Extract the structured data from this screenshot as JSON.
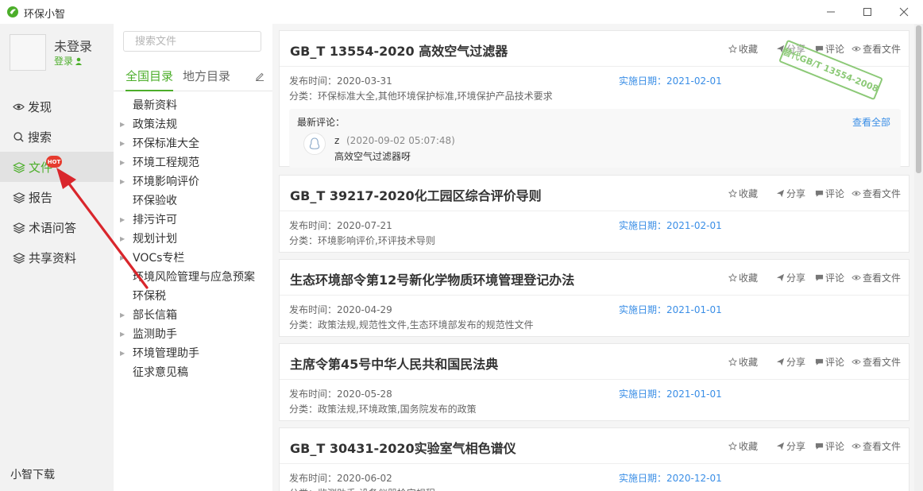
{
  "window": {
    "title": "环保小智"
  },
  "user": {
    "name": "未登录",
    "login_label": "登录"
  },
  "nav": {
    "items": [
      {
        "label": "发现",
        "icon": "eye-icon"
      },
      {
        "label": "搜索",
        "icon": "search-icon"
      },
      {
        "label": "文件",
        "icon": "layers-icon",
        "active": true,
        "badge": "HOT"
      },
      {
        "label": "报告",
        "icon": "layers-icon"
      },
      {
        "label": "术语问答",
        "icon": "layers-icon"
      },
      {
        "label": "共享资料",
        "icon": "layers-icon"
      }
    ],
    "download_label": "小智下载"
  },
  "directory": {
    "search_placeholder": "搜索文件",
    "tabs": [
      "全国目录",
      "地方目录"
    ],
    "items": [
      {
        "label": "最新资料",
        "expandable": false
      },
      {
        "label": "政策法规",
        "expandable": true
      },
      {
        "label": "环保标准大全",
        "expandable": true
      },
      {
        "label": "环境工程规范",
        "expandable": true
      },
      {
        "label": "环境影响评价",
        "expandable": true
      },
      {
        "label": "环保验收",
        "expandable": false
      },
      {
        "label": "排污许可",
        "expandable": true
      },
      {
        "label": "规划计划",
        "expandable": true
      },
      {
        "label": "VOCs专栏",
        "expandable": true
      },
      {
        "label": "环境风险管理与应急预案",
        "expandable": false
      },
      {
        "label": "环保税",
        "expandable": false
      },
      {
        "label": "部长信箱",
        "expandable": true
      },
      {
        "label": "监测助手",
        "expandable": true
      },
      {
        "label": "环境管理助手",
        "expandable": true
      },
      {
        "label": "征求意见稿",
        "expandable": false
      }
    ]
  },
  "actions": {
    "fav": "收藏",
    "share": "分享",
    "comment": "评论",
    "view": "查看文件"
  },
  "labels": {
    "publish": "发布时间：",
    "implement": "实施日期：",
    "category": "分类："
  },
  "docs": [
    {
      "title": "GB_T 13554-2020 高效空气过滤器",
      "publish": "2020-03-31",
      "implement": "2021-02-01",
      "category": "环保标准大全,其他环境保护标准,环境保护产品技术要求",
      "stamp": "替代GB/T 13554-2008",
      "comment": {
        "label": "最新评论：",
        "view_all": "查看全部",
        "user": "z",
        "time": "(2020-09-02 05:07:48)",
        "text": "高效空气过滤器呀"
      }
    },
    {
      "title": "GB_T 39217-2020化工园区综合评价导则",
      "publish": "2020-07-21",
      "implement": "2021-02-01",
      "category": "环境影响评价,环评技术导则"
    },
    {
      "title": "生态环境部令第12号新化学物质环境管理登记办法",
      "publish": "2020-04-29",
      "implement": "2021-01-01",
      "category": "政策法规,规范性文件,生态环境部发布的规范性文件"
    },
    {
      "title": "主席令第45号中华人民共和国民法典",
      "publish": "2020-05-28",
      "implement": "2021-01-01",
      "category": "政策法规,环境政策,国务院发布的政策"
    },
    {
      "title": "GB_T 30431-2020实验室气相色谱仪",
      "publish": "2020-06-02",
      "implement": "2020-12-01",
      "category": "监测助手,设备仪器检定规程"
    }
  ],
  "colors": {
    "accent": "#4cae2a",
    "link": "#3a8ee6",
    "hot": "#e63b2e",
    "annotation": "#d9262c"
  }
}
